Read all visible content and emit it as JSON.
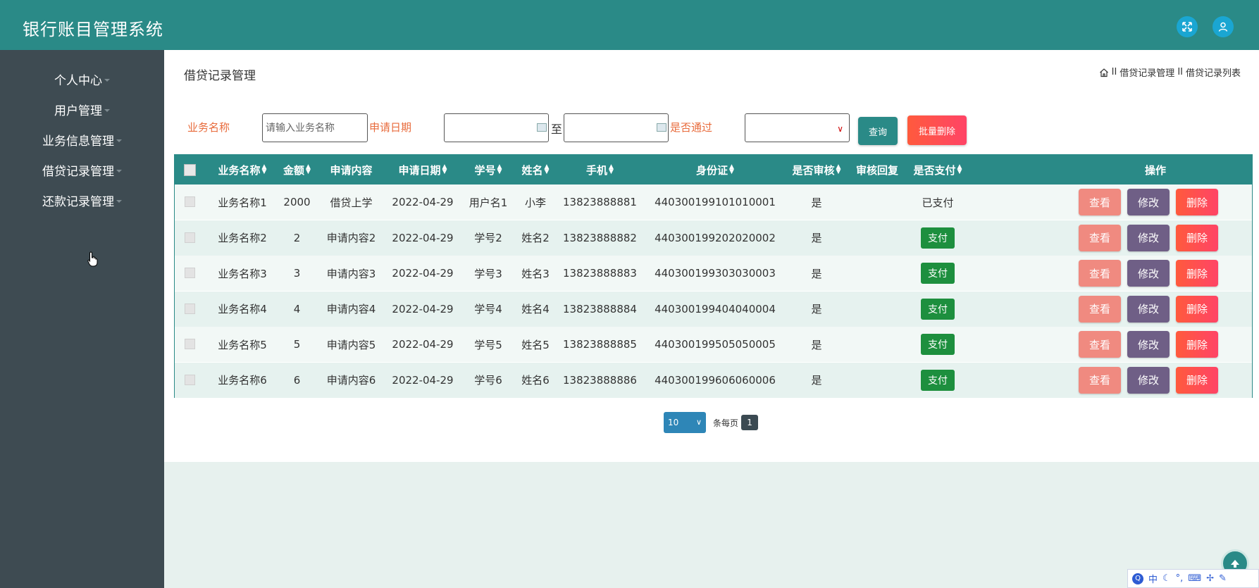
{
  "app": {
    "title": "银行账目管理系统"
  },
  "sidebar": {
    "items": [
      {
        "label": "个人中心"
      },
      {
        "label": "用户管理"
      },
      {
        "label": "业务信息管理"
      },
      {
        "label": "借贷记录管理"
      },
      {
        "label": "还款记录管理"
      }
    ]
  },
  "page": {
    "title": "借贷记录管理",
    "breadcrumb": {
      "sep": "II",
      "items": [
        "借贷记录管理",
        "借贷记录列表"
      ]
    }
  },
  "filters": {
    "business_name_label": "业务名称",
    "business_name_placeholder": "请输入业务名称",
    "apply_date_label": "申请日期",
    "to_text": "至",
    "passed_label": "是否通过",
    "query_label": "查询",
    "batch_delete_label": "批量删除"
  },
  "table": {
    "columns": [
      "业务名称",
      "金额",
      "申请内容",
      "申请日期",
      "学号",
      "姓名",
      "手机",
      "身份证",
      "是否审核",
      "审核回复",
      "是否支付",
      "操作"
    ],
    "rows": [
      {
        "name": "业务名称1",
        "amount": "2000",
        "content": "借贷上学",
        "date": "2022-04-29",
        "student_id": "用户名1",
        "person": "小李",
        "phone": "13823888881",
        "id_card": "440300199101010001",
        "reviewed": "是",
        "reply": "",
        "paid": "已支付"
      },
      {
        "name": "业务名称2",
        "amount": "2",
        "content": "申请内容2",
        "date": "2022-04-29",
        "student_id": "学号2",
        "person": "姓名2",
        "phone": "13823888882",
        "id_card": "440300199202020002",
        "reviewed": "是",
        "reply": "",
        "paid": "支付"
      },
      {
        "name": "业务名称3",
        "amount": "3",
        "content": "申请内容3",
        "date": "2022-04-29",
        "student_id": "学号3",
        "person": "姓名3",
        "phone": "13823888883",
        "id_card": "440300199303030003",
        "reviewed": "是",
        "reply": "",
        "paid": "支付"
      },
      {
        "name": "业务名称4",
        "amount": "4",
        "content": "申请内容4",
        "date": "2022-04-29",
        "student_id": "学号4",
        "person": "姓名4",
        "phone": "13823888884",
        "id_card": "440300199404040004",
        "reviewed": "是",
        "reply": "",
        "paid": "支付"
      },
      {
        "name": "业务名称5",
        "amount": "5",
        "content": "申请内容5",
        "date": "2022-04-29",
        "student_id": "学号5",
        "person": "姓名5",
        "phone": "13823888885",
        "id_card": "440300199505050005",
        "reviewed": "是",
        "reply": "",
        "paid": "支付"
      },
      {
        "name": "业务名称6",
        "amount": "6",
        "content": "申请内容6",
        "date": "2022-04-29",
        "student_id": "学号6",
        "person": "姓名6",
        "phone": "13823888886",
        "id_card": "440300199606060006",
        "reviewed": "是",
        "reply": "",
        "paid": "支付"
      }
    ],
    "actions": {
      "view": "查看",
      "edit": "修改",
      "delete": "删除"
    }
  },
  "pagination": {
    "page_size": "10",
    "per_page_label": "条每页",
    "current_page": "1"
  },
  "ime": {
    "lang": "中",
    "punct": "°,",
    "keyboard_icon": "keyboard-icon"
  },
  "colors": {
    "primary": "#2a8a87",
    "sidebar": "#3e4b52",
    "danger": "#ff4d4d",
    "success": "#1d8f3e",
    "edit": "#6f5f86",
    "view": "#f08a80",
    "label": "#e86b3c"
  }
}
